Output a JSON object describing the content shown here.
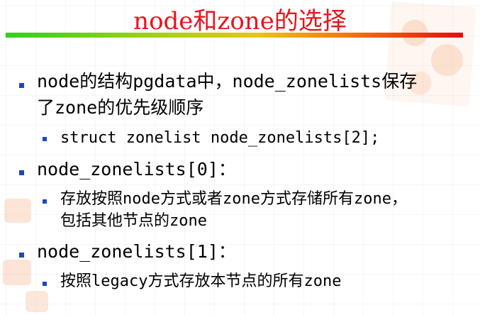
{
  "slide": {
    "title": "node和zone的选择",
    "bullets": [
      {
        "lines": [
          "node的结构pgdata中，node_zonelists保存",
          "了zone的优先级顺序"
        ],
        "sub": [
          {
            "lines": [
              "struct zonelist node_zonelists[2];"
            ]
          }
        ]
      },
      {
        "lines": [
          "node_zonelists[0]："
        ],
        "sub": [
          {
            "lines": [
              "存放按照node方式或者zone方式存储所有zone，",
              "包括其他节点的zone"
            ]
          }
        ]
      },
      {
        "lines": [
          "node_zonelists[1]："
        ],
        "sub": [
          {
            "lines": [
              "按照legacy方式存放本节点的所有zone"
            ]
          }
        ]
      }
    ]
  },
  "colors": {
    "title": "#e8141b",
    "bullet": "#1f47b8",
    "rule_gradient": [
      "#30d020",
      "#e7c51a",
      "#e01010"
    ]
  }
}
